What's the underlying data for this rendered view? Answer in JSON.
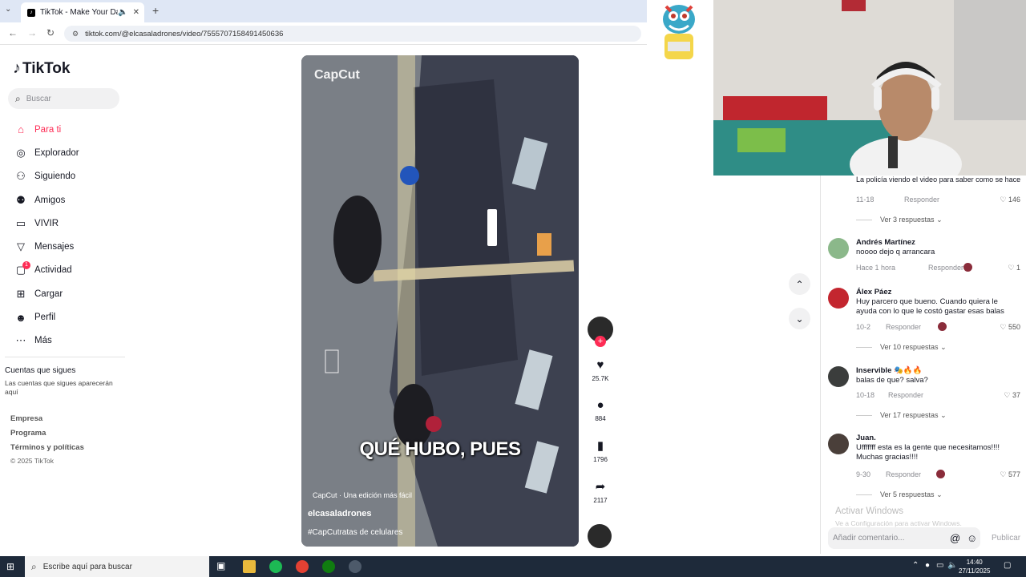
{
  "browser": {
    "tab_title": "TikTok - Make Your Day",
    "url": "tiktok.com/@elcasaladrones/video/7555707158491450636"
  },
  "sidebar": {
    "logo": "TikTok",
    "search_placeholder": "Buscar",
    "menu": [
      {
        "label": "Para ti",
        "icon": "home-icon"
      },
      {
        "label": "Explorador",
        "icon": "compass-icon"
      },
      {
        "label": "Siguiendo",
        "icon": "user-follow-icon"
      },
      {
        "label": "Amigos",
        "icon": "friends-icon"
      },
      {
        "label": "VIVIR",
        "icon": "live-icon"
      },
      {
        "label": "Mensajes",
        "icon": "messages-icon"
      },
      {
        "label": "Actividad",
        "icon": "activity-icon",
        "badge": "1"
      },
      {
        "label": "Cargar",
        "icon": "upload-icon"
      },
      {
        "label": "Perfil",
        "icon": "profile-icon"
      },
      {
        "label": "Más",
        "icon": "more-icon"
      }
    ],
    "following_title": "Cuentas que sigues",
    "following_desc": "Las cuentas que sigues aparecerán aquí",
    "footer": [
      "Empresa",
      "Programa",
      "Términos y políticas"
    ],
    "copyright": "© 2025 TikTok"
  },
  "video": {
    "watermark": "CapCut",
    "caption": "QUÉ HUBO, PUES",
    "capcut_tag": "CapCut · Una edición más fácil",
    "username": "elcasaladrones",
    "description": "#CapCutratas de celulares"
  },
  "actions": {
    "likes": "25.7K",
    "comments": "884",
    "saves": "1796",
    "shares": "2117"
  },
  "comments": {
    "top_text": "La policía viendo el video para saber como se hace",
    "top_date": "11-18",
    "top_likes": "146",
    "top_replies": "Ver 3 respuestas",
    "reply_label": "Responder",
    "items": [
      {
        "name": "Andrés Martínez",
        "text": "noooo dejo q arrancara",
        "date": "Hace 1 hora",
        "likes": "1"
      },
      {
        "name": "Álex Páez",
        "text": "Huy parcero que bueno. Cuando quiera le ayuda con lo que le costó gastar esas balas",
        "date": "10-2",
        "likes": "550",
        "replies": "Ver 10 respuestas"
      },
      {
        "name": "Inservible 🎭🔥🔥",
        "text": "balas de que? salva?",
        "date": "10-18",
        "likes": "37",
        "replies": "Ver 17 respuestas"
      },
      {
        "name": "Juan.",
        "text": "Ufffffff esta es la gente que necesitamos!!!! Muchas gracias!!!!",
        "date": "9-30",
        "likes": "577",
        "replies": "Ver 5 respuestas"
      }
    ],
    "activate_title": "Activar Windows",
    "activate_desc": "Ve a Configuración para activar Windows.",
    "input_placeholder": "Añadir comentario...",
    "publish": "Publicar"
  },
  "taskbar": {
    "search_placeholder": "Escribe aquí para buscar",
    "time": "14:40",
    "date": "27/11/2025"
  }
}
